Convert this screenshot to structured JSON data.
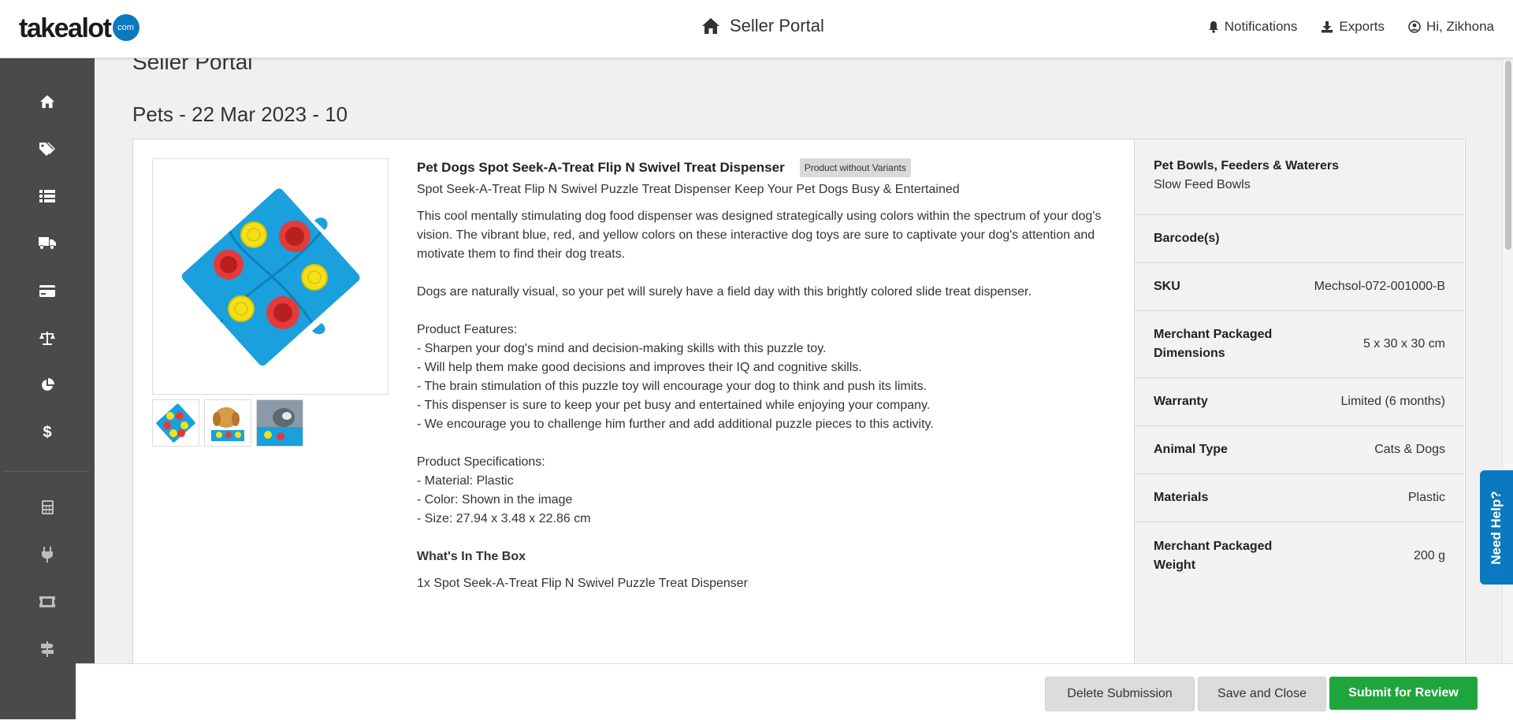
{
  "header": {
    "logo_text": "takealot",
    "logo_badge": "com",
    "title": "Seller Portal",
    "notifications": "Notifications",
    "exports": "Exports",
    "user_greeting": "Hi, Zikhona"
  },
  "sidebar": {
    "icons": [
      "home-icon",
      "tags-icon",
      "list-icon",
      "truck-icon",
      "credit-card-icon",
      "scales-icon",
      "pie-chart-icon",
      "dollar-icon",
      "calculator-icon",
      "plug-icon",
      "ticket-icon",
      "signpost-icon"
    ]
  },
  "page": {
    "heading": "Seller Portal",
    "batch_title": "Pets - 22 Mar 2023 - 10"
  },
  "product": {
    "title": "Pet Dogs Spot Seek-A-Treat Flip N Swivel Treat Dispenser",
    "badge": "Product without Variants",
    "subtitle": "Spot Seek-A-Treat Flip N Swivel Puzzle Treat Dispenser Keep Your Pet Dogs Busy & Entertained",
    "description_intro": "This cool mentally stimulating dog food dispenser was designed strategically using colors within the spectrum of your dog's vision. The vibrant blue, red, and yellow colors on these interactive dog toys are sure to captivate your dog's attention and motivate them to find their dog treats.",
    "description_visual": "Dogs are naturally visual, so your pet will surely have a field day with this brightly colored slide treat dispenser.",
    "features_heading": "Product Features:",
    "features": [
      "- Sharpen your dog's mind and decision-making skills with this puzzle toy.",
      "- Will help them make good decisions and improves their IQ and cognitive skills.",
      "- The brain stimulation of this puzzle toy will encourage your dog to think and push its limits.",
      "- This dispenser is sure to keep your pet busy and entertained while enjoying your company.",
      "- We encourage you to challenge him further and add additional puzzle pieces to this activity."
    ],
    "specs_heading": "Product Specifications:",
    "specs": [
      "- Material: Plastic",
      "- Color: Shown in the image",
      "- Size: 27.94 x 3.48 x 22.86 cm"
    ],
    "box_heading": "What's In The Box",
    "box_contents": "1x Spot Seek-A-Treat Flip N Swivel Puzzle Treat Dispenser"
  },
  "details": {
    "category_main": "Pet Bowls, Feeders & Waterers",
    "category_sub": "Slow Feed Bowls",
    "barcodes_label": "Barcode(s)",
    "rows": [
      {
        "label": "SKU",
        "value": "Mechsol-072-001000-B"
      },
      {
        "label": "Merchant Packaged Dimensions",
        "value": "5 x 30 x 30 cm"
      },
      {
        "label": "Warranty",
        "value": "Limited (6 months)"
      },
      {
        "label": "Animal Type",
        "value": "Cats & Dogs"
      },
      {
        "label": "Materials",
        "value": "Plastic"
      },
      {
        "label": "Merchant Packaged Weight",
        "value": "200 g"
      }
    ]
  },
  "footer": {
    "delete_label": "Delete Submission",
    "save_label": "Save and Close",
    "submit_label": "Submit for Review"
  },
  "help": {
    "label": "Need Help?"
  },
  "colors": {
    "brand_blue": "#0b79bf",
    "submit_green": "#1ea63d",
    "sidebar_bg": "#4a4a4a"
  }
}
